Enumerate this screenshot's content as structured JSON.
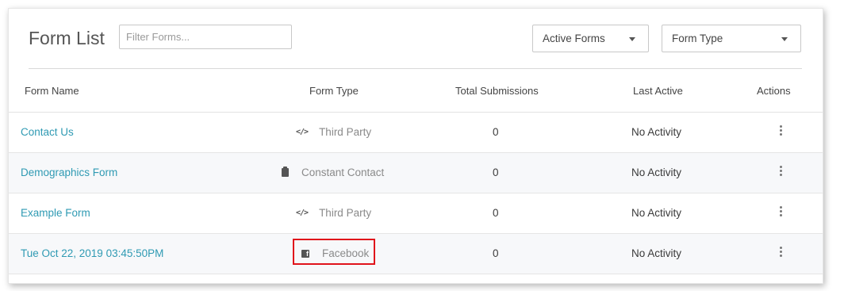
{
  "header": {
    "title": "Form List",
    "filter_placeholder": "Filter Forms...",
    "status_dropdown": "Active Forms",
    "type_dropdown": "Form Type"
  },
  "table": {
    "columns": [
      "Form Name",
      "Form Type",
      "Total Submissions",
      "Last Active",
      "Actions"
    ],
    "rows": [
      {
        "name": "Contact Us",
        "type": "Third Party",
        "type_icon": "code-icon",
        "submissions": "0",
        "last_active": "No Activity"
      },
      {
        "name": "Demographics Form",
        "type": "Constant Contact",
        "type_icon": "clipboard-icon",
        "submissions": "0",
        "last_active": "No Activity"
      },
      {
        "name": "Example Form",
        "type": "Third Party",
        "type_icon": "code-icon",
        "submissions": "0",
        "last_active": "No Activity"
      },
      {
        "name": "Tue Oct 22, 2019 03:45:50PM",
        "type": "Facebook",
        "type_icon": "facebook-icon",
        "submissions": "0",
        "last_active": "No Activity"
      }
    ]
  },
  "colors": {
    "link": "#2f9ab3",
    "highlight": "#e0131b",
    "row_alt": "#f7f8fa"
  }
}
